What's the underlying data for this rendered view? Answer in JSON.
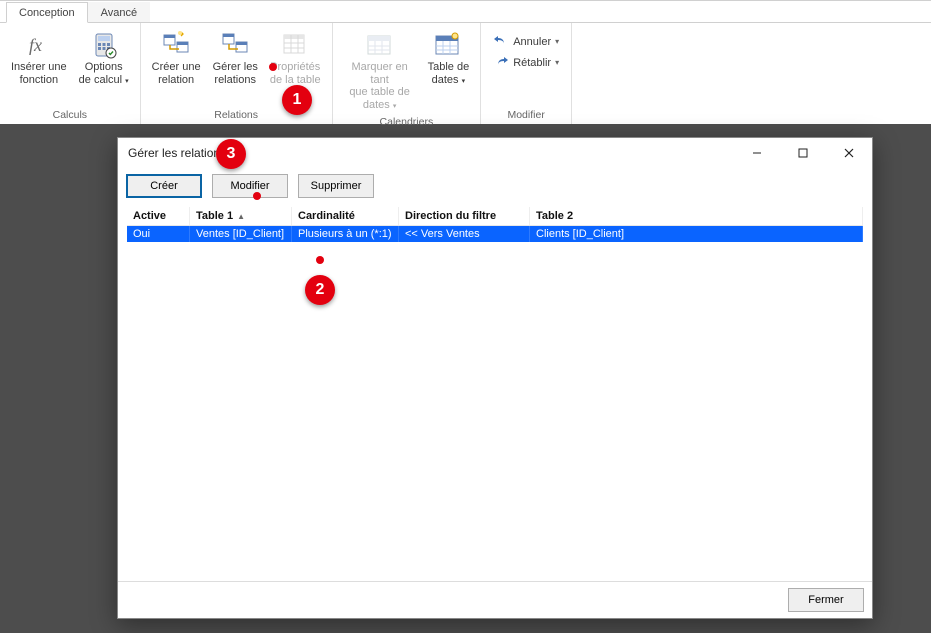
{
  "tabs": {
    "conception": "Conception",
    "avance": "Avancé"
  },
  "ribbon": {
    "groups": {
      "calculs": {
        "label": "Calculs",
        "inserer_fonction": "Insérer une\nfonction",
        "options_calcul": "Options\nde calcul"
      },
      "relations": {
        "label": "Relations",
        "creer_relation": "Créer une\nrelation",
        "gerer_relations": "Gérer les\nrelations",
        "proprietes_table": "Propriétés\nde la table"
      },
      "calendriers": {
        "label": "Calendriers",
        "marquer_tant": "Marquer en tant\nque table de dates",
        "table_dates": "Table de\ndates"
      },
      "modifier": {
        "label": "Modifier",
        "annuler": "Annuler",
        "retablir": "Rétablir"
      }
    }
  },
  "dialog": {
    "title": "Gérer les relations",
    "buttons": {
      "creer": "Créer",
      "modifier": "Modifier",
      "supprimer": "Supprimer",
      "fermer": "Fermer"
    },
    "columns": {
      "active": "Active",
      "table1": "Table 1",
      "cardinalite": "Cardinalité",
      "filtre": "Direction du filtre",
      "table2": "Table 2"
    },
    "row": {
      "active": "Oui",
      "table1": "Ventes [ID_Client]",
      "cardinalite": "Plusieurs à un (*:1)",
      "filtre": "<< Vers Ventes",
      "table2": "Clients [ID_Client]"
    }
  },
  "annotations": {
    "b1": "1",
    "b2": "2",
    "b3": "3"
  }
}
